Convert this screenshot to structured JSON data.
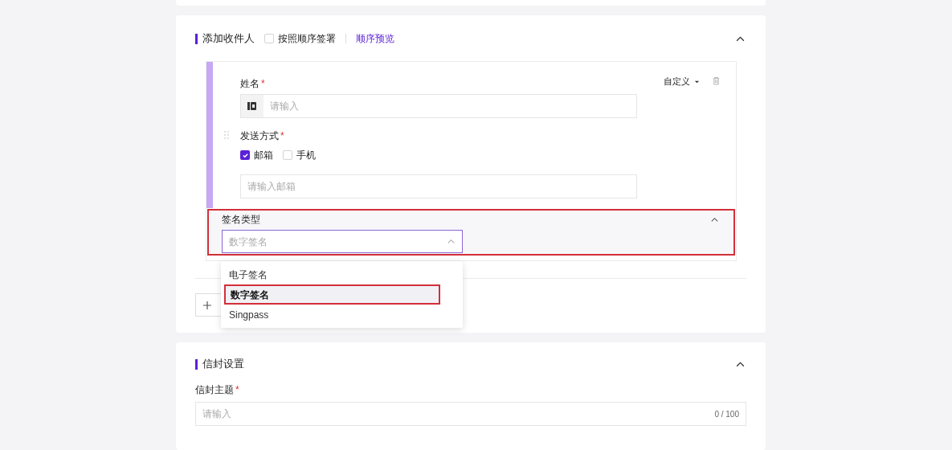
{
  "recipients_section": {
    "title": "添加收件人",
    "sequential": {
      "label": "按照顺序签署",
      "checked": false
    },
    "preview_link": "顺序预览",
    "expanded": true,
    "recipient": {
      "role": "自定义",
      "name_label": "姓名",
      "name_required": "*",
      "send_required": "*",
      "name_placeholder": "请输入",
      "send_label": "发送方式",
      "methods": [
        {
          "label": "邮箱",
          "checked": true
        },
        {
          "label": "手机",
          "checked": false
        }
      ],
      "email_placeholder": "请输入邮箱",
      "sign_type": {
        "label": "签名类型",
        "value": "数字签名",
        "highlighted": true,
        "open": true,
        "options": [
          {
            "label": "电子签名",
            "selected": false,
            "highlighted": false
          },
          {
            "label": "数字签名",
            "selected": true,
            "highlighted": true
          },
          {
            "label": "Singpass",
            "selected": false,
            "highlighted": false
          }
        ]
      }
    }
  },
  "envelope_section": {
    "title": "信封设置",
    "expanded": true,
    "subject_label": "信封主题",
    "subject_required": "*",
    "subject_placeholder": "请输入",
    "counter": "0 / 100"
  }
}
